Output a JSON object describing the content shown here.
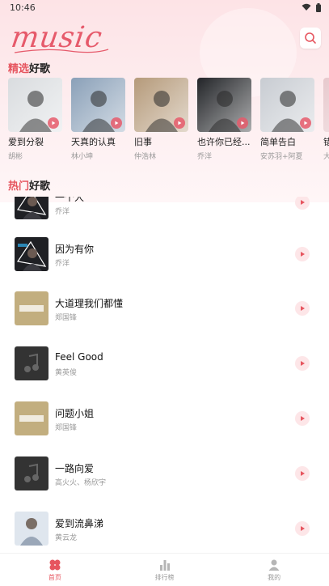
{
  "status_bar": {
    "time": "10:46"
  },
  "header": {
    "logo_text": "music"
  },
  "featured": {
    "title_highlight": "精选",
    "title_rest": "好歌",
    "items": [
      {
        "title": "爱到分裂",
        "artist": "胡彬",
        "cover_color": "#d9dcdf"
      },
      {
        "title": "天真的认真",
        "artist": "林小坤",
        "cover_color": "#8aa0b8"
      },
      {
        "title": "旧事",
        "artist": "仲浩林",
        "cover_color": "#b59a7a"
      },
      {
        "title": "也许你已经...",
        "artist": "乔洋",
        "cover_color": "#222428"
      },
      {
        "title": "简单告白",
        "artist": "安苏羽+阿夏",
        "cover_color": "#c8ccd2"
      },
      {
        "title": "错",
        "artist": "大",
        "cover_color": "#e7c9cd"
      }
    ]
  },
  "hot": {
    "title_highlight": "热门",
    "title_rest": "好歌",
    "items": [
      {
        "title": "一个人",
        "artist": "乔洋",
        "cover": "dark-art"
      },
      {
        "title": "因为有你",
        "artist": "乔洋",
        "cover": "dark-art"
      },
      {
        "title": "大道理我们都懂",
        "artist": "郑国锋",
        "cover": "gold"
      },
      {
        "title": "Feel Good",
        "artist": "黄英俊",
        "cover": "note"
      },
      {
        "title": "问题小姐",
        "artist": "郑国锋",
        "cover": "gold"
      },
      {
        "title": "一路向爱",
        "artist": "高火火、杨欣宇",
        "cover": "note"
      },
      {
        "title": "爱到流鼻涕",
        "artist": "黄云龙",
        "cover": "photo"
      }
    ]
  },
  "bottom_nav": [
    {
      "label": "首页",
      "icon": "home-icon",
      "active": true
    },
    {
      "label": "排行榜",
      "icon": "chart-icon",
      "active": false
    },
    {
      "label": "我的",
      "icon": "user-icon",
      "active": false
    }
  ],
  "colors": {
    "accent": "#e6555f",
    "header_bg": "#fde3e6",
    "gold_cover": "#c2ae7f",
    "note_cover": "#333333"
  }
}
